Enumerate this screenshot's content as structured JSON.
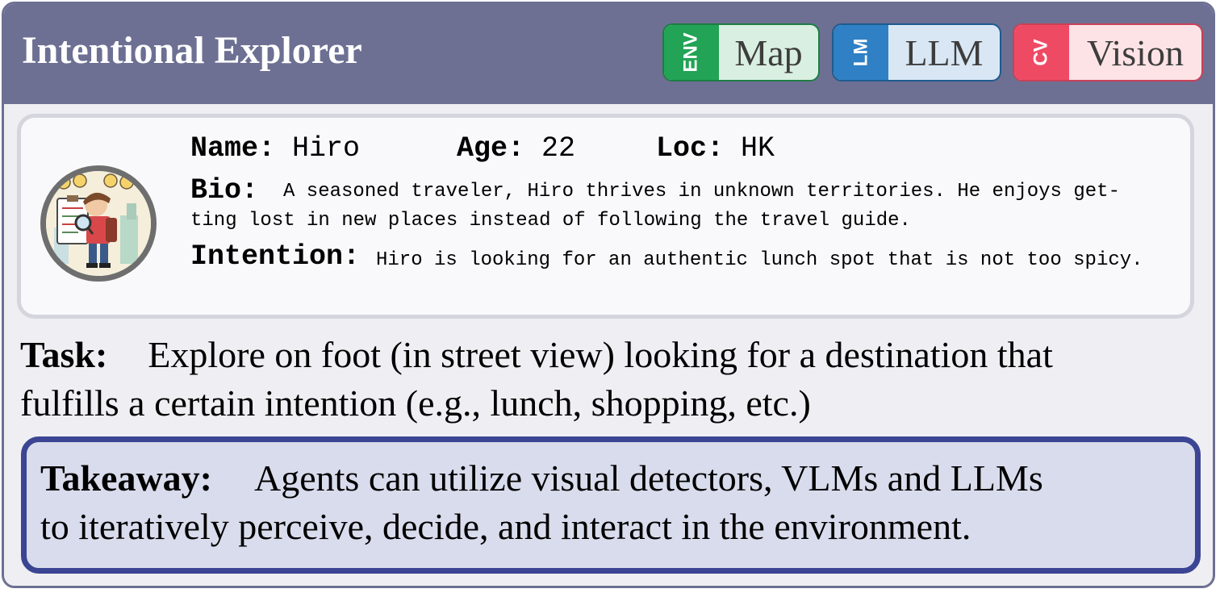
{
  "header": {
    "title": "Intentional Explorer",
    "tags": [
      {
        "code": "ENV",
        "label": "Map",
        "color": "#22a355"
      },
      {
        "code": "LM",
        "label": "LLM",
        "color": "#2f80c4"
      },
      {
        "code": "CV",
        "label": "Vision",
        "color": "#ef4a64"
      }
    ]
  },
  "profile": {
    "name_label": "Name:",
    "name": "Hiro",
    "age_label": "Age:",
    "age": "22",
    "loc_label": "Loc:",
    "loc": "HK",
    "bio_label": "Bio:",
    "bio_line1": "A seasoned traveler, Hiro thrives in unknown territories. He enjoys get-",
    "bio_line2": "ting lost in new places instead of following the travel guide.",
    "intention_label": "Intention:",
    "intention": "Hiro is looking for an authentic lunch spot that is not too spicy.",
    "avatar_icon": "explorer-character-avatar"
  },
  "task": {
    "label": "Task:",
    "line1": "Explore on foot (in street view) looking for a destination that",
    "line2": "fulfills a certain intention (e.g., lunch, shopping, etc.)"
  },
  "takeaway": {
    "label": "Takeaway:",
    "line1": "Agents can utilize visual detectors, VLMs and LLMs",
    "line2": "to iteratively perceive, decide, and interact in the environment."
  }
}
